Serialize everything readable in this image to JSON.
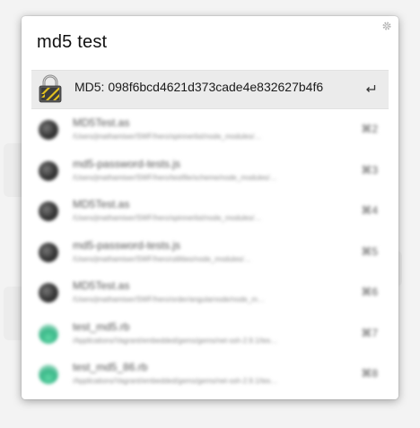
{
  "query": "md5 test",
  "top_result": {
    "title": "MD5: 098f6bcd4621d373cade4e832627b4f6",
    "icon": "padlock-icon",
    "action_icon": "return-key-icon"
  },
  "settings_icon": "gear-icon",
  "results": [
    {
      "title": "MD5Test.as",
      "path": "/Users/jmathamiser/SWF/hero/spinnerlist/node_modules/…",
      "shortcut": "⌘2",
      "icon": "dark"
    },
    {
      "title": "md5-password-tests.js",
      "path": "/Users/jmathamiser/SWF/hero/testfile/scheme/node_modules/…",
      "shortcut": "⌘3",
      "icon": "dark"
    },
    {
      "title": "MD5Test.as",
      "path": "/Users/jmathamiser/SWF/hero/spinnerlist/node_modules/…",
      "shortcut": "⌘4",
      "icon": "dark"
    },
    {
      "title": "md5-password-tests.js",
      "path": "/Users/jmathamiser/SWF/hero/utilities/node_modules/…",
      "shortcut": "⌘5",
      "icon": "dark"
    },
    {
      "title": "MD5Test.as",
      "path": "/Users/jmathamiser/SWF/hero/order/angularnode/node_m…",
      "shortcut": "⌘6",
      "icon": "dark"
    },
    {
      "title": "test_md5.rb",
      "path": "/Applications/Vagrant/embedded/gems/gems/net-ssh-2.9.1/tes…",
      "shortcut": "⌘7",
      "icon": "green"
    },
    {
      "title": "test_md5_86.rb",
      "path": "/Applications/Vagrant/embedded/gems/gems/net-ssh-2.9.1/tes…",
      "shortcut": "⌘8",
      "icon": "green"
    }
  ]
}
